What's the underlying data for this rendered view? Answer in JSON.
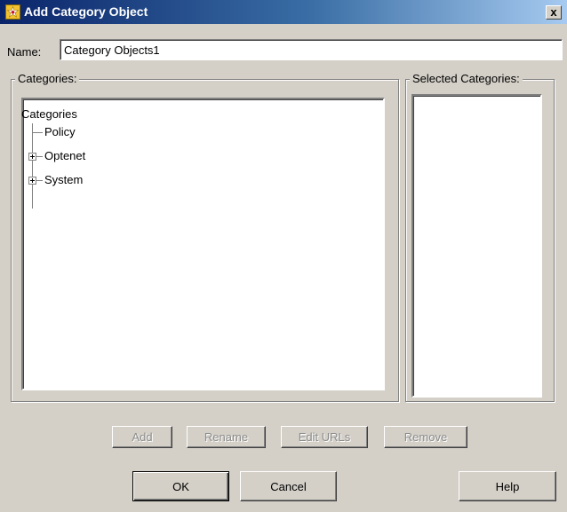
{
  "window": {
    "title": "Add Category Object",
    "close_label": "x"
  },
  "name_field": {
    "label": "Name:",
    "value": "Category Objects1"
  },
  "categories_group": {
    "label": "Categories:",
    "tree": {
      "root": "Categories",
      "children": [
        {
          "label": "Policy",
          "expandable": false
        },
        {
          "label": "Optenet",
          "expandable": true
        },
        {
          "label": "System",
          "expandable": true
        }
      ]
    }
  },
  "selected_group": {
    "label": "Selected Categories:"
  },
  "action_buttons": {
    "add": "Add",
    "rename": "Rename",
    "edit_urls": "Edit URLs",
    "remove": "Remove"
  },
  "dialog_buttons": {
    "ok": "OK",
    "cancel": "Cancel",
    "help": "Help"
  },
  "colors": {
    "title_gradient_start": "#0a246a",
    "title_gradient_end": "#a6caf0",
    "dialog_background": "#d4d0c8"
  }
}
